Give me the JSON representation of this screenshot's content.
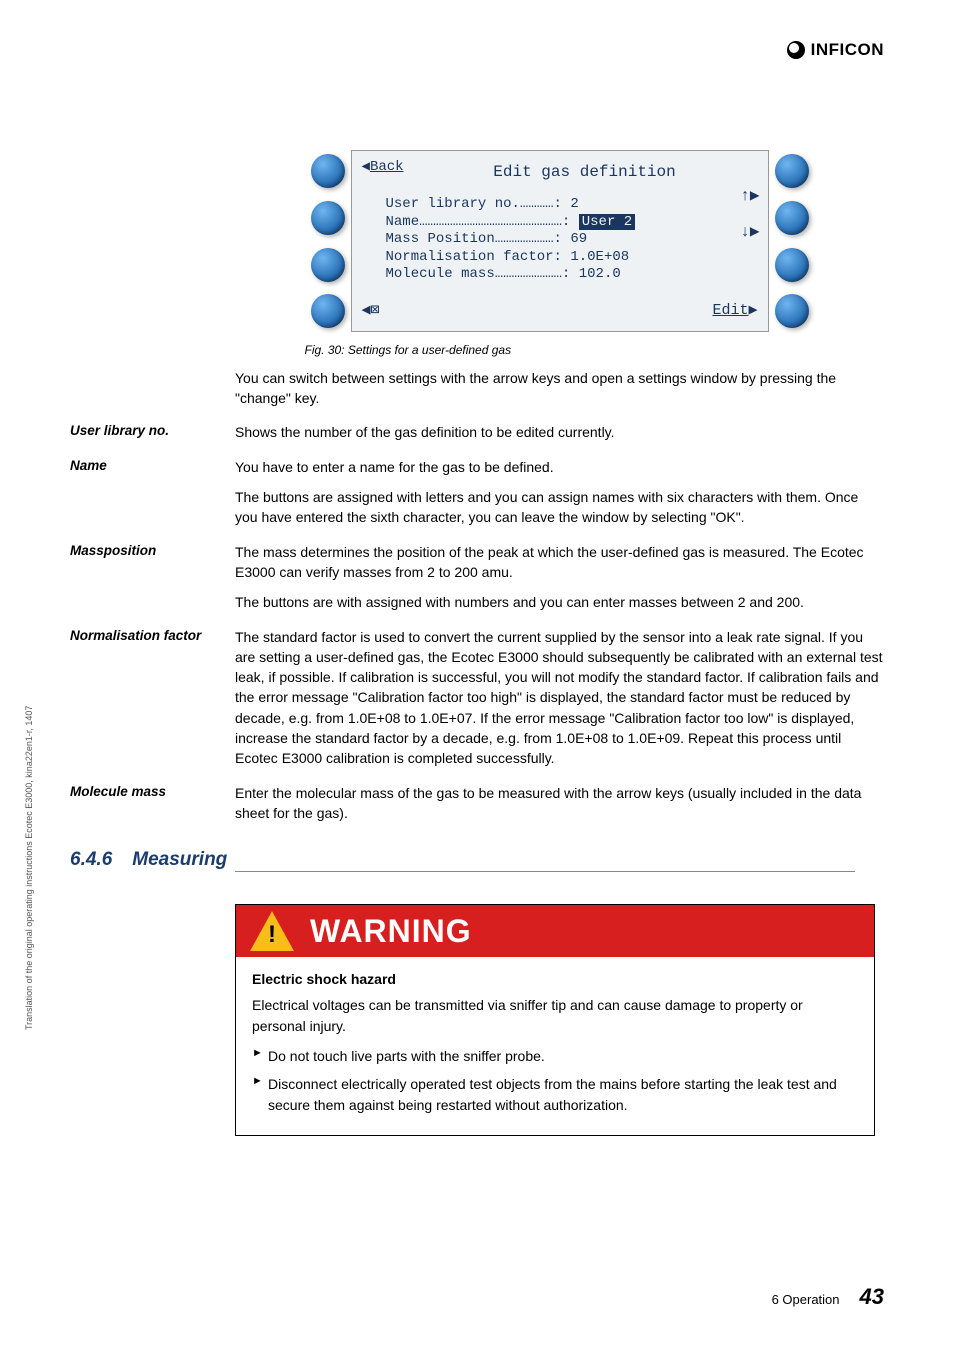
{
  "brand": {
    "name": "INFICON"
  },
  "screenshot": {
    "back_label": "Back",
    "title": "Edit gas definition",
    "lines": {
      "l1a": "User library no.…………:",
      "l1b": "2",
      "l2a": "Name……………………………………………:",
      "l2b": "User 2",
      "l3a": "Mass Position…………………:",
      "l3b": "69",
      "l4a": "Normalisation factor:",
      "l4b": "1.0E+08",
      "l5a": "Molecule mass……………………:",
      "l5b": "102.0"
    },
    "footer_left": "◀⊠",
    "footer_right": "Edit",
    "arrow_up": "↑▶",
    "arrow_down": "↓▶"
  },
  "fig_caption": "Fig. 30: Settings for a user-defined gas",
  "after_fig": "You can switch between settings with the arrow keys and open a settings window by pressing the \"change\" key.",
  "rows": {
    "user_lib": {
      "label": "User library no.",
      "p1": "Shows the number of the gas definition to be edited currently."
    },
    "name": {
      "label": "Name",
      "p1": "You have to enter a name for the gas to be defined.",
      "p2": "The buttons are assigned with letters and you can assign names with six characters with them. Once you have entered the sixth character, you can leave the window by selecting \"OK\"."
    },
    "mass": {
      "label": "Massposition",
      "p1": "The mass determines the position of the peak at which the user-defined gas is measured. The Ecotec E3000 can verify masses from 2 to 200 amu.",
      "p2": "The buttons are with assigned with numbers and you can enter masses between 2 and 200."
    },
    "norm": {
      "label": "Normalisation factor",
      "p1": "The standard factor is used to convert the current supplied by the sensor into a leak rate signal. If you are setting a user-defined gas, the Ecotec E3000 should subsequently be calibrated with an external test leak, if possible. If calibration is successful, you will not modify the standard factor. If calibration fails and the error message \"Calibration factor too high\" is displayed, the standard factor must be reduced by decade, e.g. from 1.0E+08 to 1.0E+07. If the error message \"Calibration factor too low\" is displayed, increase the standard factor by a decade, e.g. from 1.0E+08 to 1.0E+09. Repeat this process until Ecotec E3000 calibration is completed successfully."
    },
    "mol": {
      "label": "Molecule mass",
      "p1": "Enter the molecular mass of the gas to be measured with the arrow keys (usually included in the data sheet for the gas)."
    }
  },
  "section": {
    "num": "6.4.6",
    "title": "Measuring"
  },
  "warning": {
    "title": "WARNING",
    "sub": "Electric shock hazard",
    "p1": "Electrical voltages can be transmitted via sniffer tip and can cause damage to property or personal injury.",
    "li1": "Do not touch live parts with the sniffer probe.",
    "li2": "Disconnect electrically operated test objects from the mains before starting the leak test and secure them against being restarted without authorization."
  },
  "sidetext": "Translation of the original operating instructions Ecotec E3000, kina22en1-r, 1407",
  "footer": {
    "chapter": "6  Operation",
    "page": "43"
  }
}
